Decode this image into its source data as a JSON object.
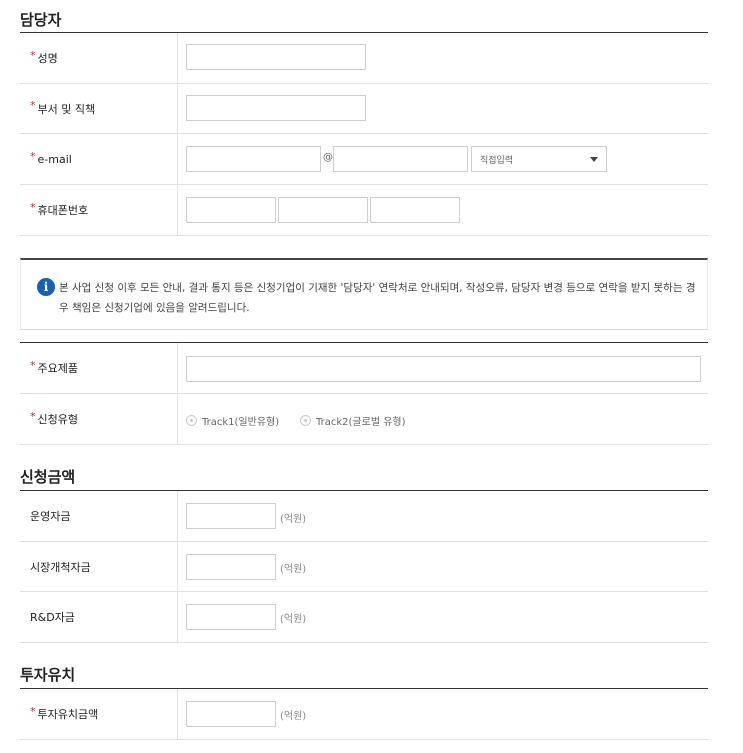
{
  "sections": {
    "contact_title": "담당자",
    "amount_title": "신청금액",
    "investment_title": "투자유치"
  },
  "required_mark": "*",
  "contact": {
    "name_label": "성명",
    "dept_label": "부서 및 직책",
    "email_label": "e-mail",
    "email_at": "@",
    "email_domain_select": "직접입력",
    "mobile_label": "휴대폰번호"
  },
  "notice": {
    "icon": "info-icon",
    "icon_glyph": "i",
    "text": "본 사업 신청 이후 모든 안내, 결과 통지 등은 신청기업이 기재한 '담당자' 연락처로 안내되며, 작성오류, 담당자 변경 등으로 연락을 받지 못하는 경우 책임은 신청기업에 있음을 알려드립니다."
  },
  "product": {
    "main_product_label": "주요제품",
    "apply_type_label": "신청유형",
    "track1": "Track1(일반유형)",
    "track2": "Track2(글로벌 유형)"
  },
  "amount": {
    "operating_label": "운영자금",
    "market_label": "시장개척자금",
    "rnd_label": "R&D자금",
    "unit": "(억원)"
  },
  "investment": {
    "amount_label": "투자유치금액",
    "unit": "(억원)"
  },
  "colors": {
    "required": "#d9232e",
    "info_icon": "#1a5fb4"
  }
}
